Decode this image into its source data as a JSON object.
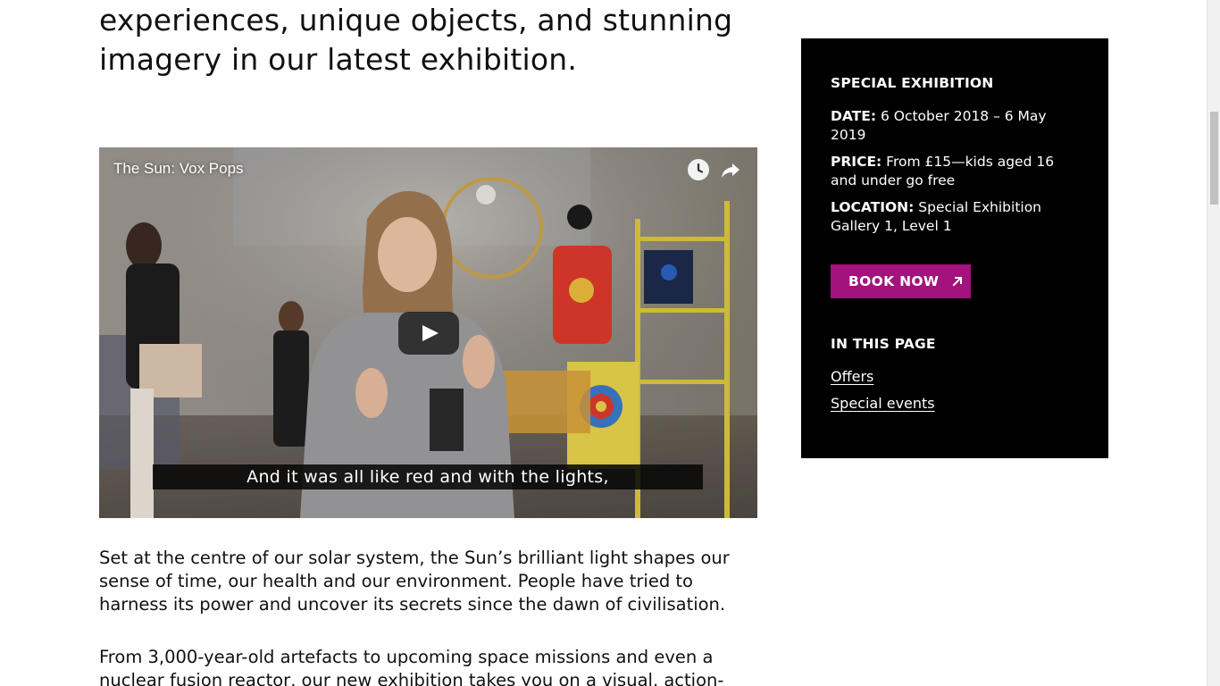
{
  "intro": {
    "line1": "experiences, unique objects, and stunning",
    "line2": "imagery in our latest exhibition."
  },
  "video": {
    "title": "The Sun: Vox Pops",
    "caption": "And it was all like red and with the lights,",
    "watch_later_icon": "clock-icon",
    "share_icon": "share-icon",
    "play_icon": "play-icon"
  },
  "paragraphs": [
    {
      "lines": [
        "Set at the centre of our solar system, the Sun’s brilliant light shapes our",
        "sense of time, our health and our environment. People have tried to",
        "harness its power and uncover its secrets since the dawn of civilisation."
      ]
    },
    {
      "lines": [
        "From 3,000-year-old artefacts to upcoming space missions and even a",
        "nuclear fusion reactor, our new exhibition takes you on a visual, action-"
      ]
    }
  ],
  "sidebar": {
    "heading": "SPECIAL EXHIBITION",
    "date_label": "DATE:",
    "date_value": "6 October 2018 – 6 May 2019",
    "price_label": "PRICE:",
    "price_value": "From £15—kids aged 16 and under go free",
    "location_label": "LOCATION:",
    "location_value": "Special Exhibition Gallery 1, Level 1",
    "book_label": "BOOK NOW",
    "in_page_heading": "IN THIS PAGE",
    "links": [
      "Offers",
      "Special events"
    ],
    "accent_color": "#a3127d"
  }
}
